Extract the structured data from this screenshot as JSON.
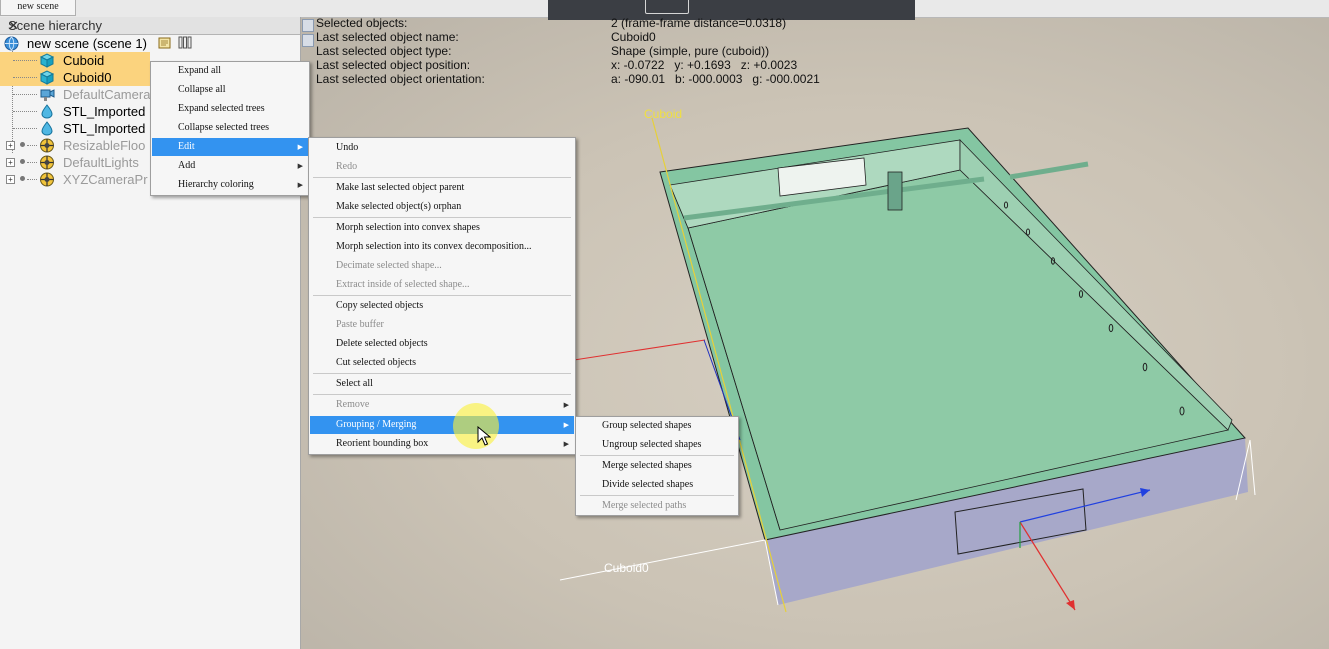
{
  "tab_label": "new scene",
  "hierarchy": {
    "title": "Scene hierarchy",
    "root": "new scene (scene 1)",
    "items": [
      {
        "label": "Cuboid",
        "state": "selected"
      },
      {
        "label": "Cuboid0",
        "state": "selected"
      },
      {
        "label": "DefaultCamera",
        "state": "dimmed"
      },
      {
        "label": "STL_Imported",
        "state": "normal"
      },
      {
        "label": "STL_Imported",
        "state": "normal"
      },
      {
        "label": "ResizableFloo",
        "state": "dimmed"
      },
      {
        "label": "DefaultLights",
        "state": "dimmed"
      },
      {
        "label": "XYZCameraPr",
        "state": "dimmed"
      }
    ]
  },
  "info": {
    "rows": [
      {
        "key": "Selected objects:",
        "value": "2 (frame-frame distance=0.0318)"
      },
      {
        "key": "Last selected object name:",
        "value": "Cuboid0"
      },
      {
        "key": "Last selected object type:",
        "value": "Shape (simple, pure (cuboid))"
      },
      {
        "key": "Last selected object position:",
        "value": "x: -0.0722   y: +0.1693   z: +0.0023"
      },
      {
        "key": "Last selected object orientation:",
        "value": "a: -090.01   b: -000.0003   g: -000.0021"
      }
    ]
  },
  "viewport": {
    "label_top": "Cuboid",
    "label_bottom": "Cuboid0",
    "colors": {
      "floor": "#cfc7b9",
      "tray_green": "#8ccaa7",
      "tray_side": "#a9a9ca",
      "label_yellow": "#f0e040"
    }
  },
  "menu1": {
    "items": [
      {
        "label": "Expand all"
      },
      {
        "label": "Collapse all"
      },
      {
        "label": "Expand selected trees"
      },
      {
        "label": "Collapse selected trees"
      },
      {
        "label": "Edit",
        "submenu": true,
        "selected": true
      },
      {
        "label": "Add",
        "submenu": true
      },
      {
        "label": "Hierarchy coloring",
        "submenu": true
      }
    ]
  },
  "menu2": {
    "items": [
      {
        "label": "Undo"
      },
      {
        "label": "Redo",
        "disabled": true
      },
      {
        "label": "Make last selected object parent"
      },
      {
        "label": "Make selected object(s) orphan"
      },
      {
        "label": "Morph selection into convex shapes"
      },
      {
        "label": "Morph selection into its convex decomposition..."
      },
      {
        "label": "Decimate selected shape...",
        "disabled": true
      },
      {
        "label": "Extract inside of selected shape...",
        "disabled": true
      },
      {
        "label": "Copy selected objects"
      },
      {
        "label": "Paste buffer",
        "disabled": true
      },
      {
        "label": "Delete selected objects"
      },
      {
        "label": "Cut selected objects"
      },
      {
        "label": "Select all"
      },
      {
        "label": "Remove",
        "disabled": true,
        "submenu": true
      },
      {
        "label": "Grouping / Merging",
        "submenu": true,
        "selected": true
      },
      {
        "label": "Reorient bounding box",
        "submenu": true
      }
    ]
  },
  "menu3": {
    "items": [
      {
        "label": "Group selected shapes"
      },
      {
        "label": "Ungroup selected shapes"
      },
      {
        "label": "Merge selected shapes"
      },
      {
        "label": "Divide selected shapes"
      },
      {
        "label": "Merge selected paths",
        "disabled": true
      }
    ]
  }
}
